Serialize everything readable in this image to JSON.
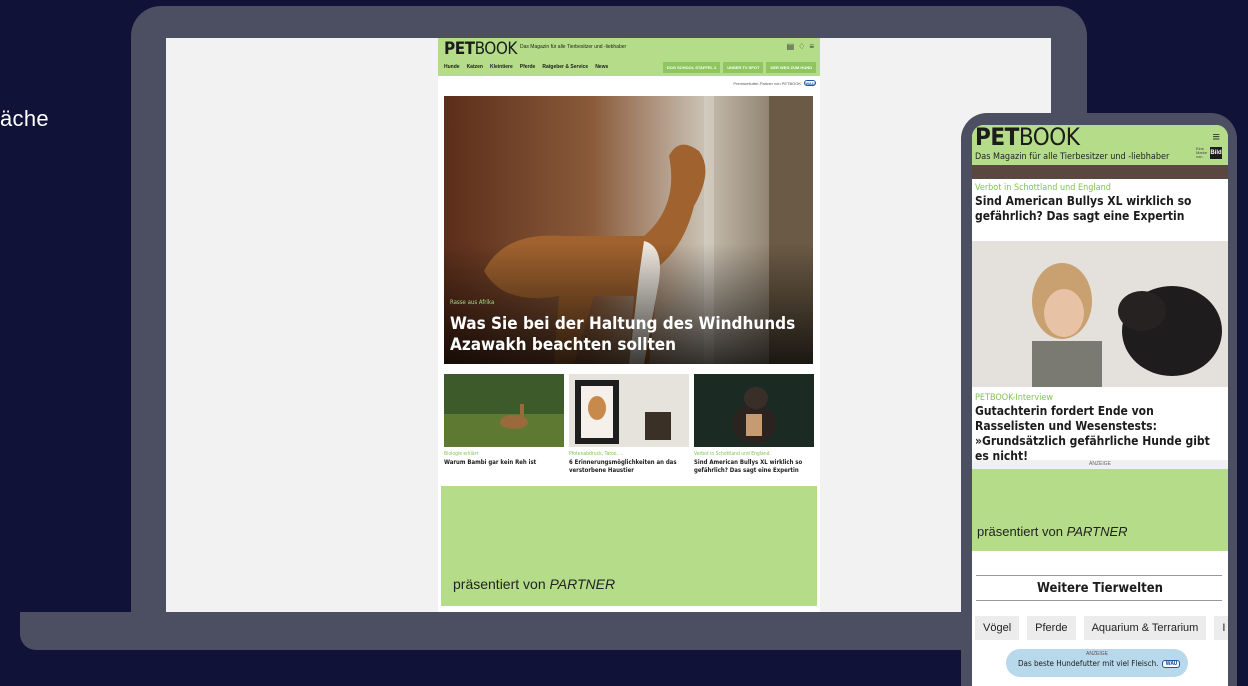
{
  "page": {
    "side_label": "äche"
  },
  "laptop": {
    "site": {
      "logo_bold": "PET",
      "logo_light": "BOOK",
      "tagline": "Das Magazin für alle Tierbesitzer und -liebhaber",
      "nav": [
        "Hunde",
        "Katzen",
        "Kleintiere",
        "Pferde",
        "Ratgeber & Service",
        "News"
      ],
      "nav_buttons": [
        "DOG SCHOOL STAFFEL 2",
        "UNSER TV SPOT",
        "DER WEG ZUM HUND"
      ],
      "partner_line": "Premiumfutter-Partner von PETBOOK",
      "wau_label": "WAU",
      "hero": {
        "kicker": "Rasse aus Afrika",
        "title": "Was Sie bei der Haltung des Windhunds Azawakh beachten sollten"
      },
      "teasers": [
        {
          "kicker": "Biologie erklärt",
          "title": "Warum Bambi gar kein Reh ist"
        },
        {
          "kicker": "Pfotenabdruck, Tatoo, ...",
          "title": "6 Erinnerungsmöglichkeiten an das verstorbene Haustier"
        },
        {
          "kicker": "Verbot in Schottland und England",
          "title": "Sind American Bullys XL wirklich so gefährlich? Das sagt eine Expertin"
        }
      ],
      "ad": {
        "prefix": "präsentiert von ",
        "partner": "PARTNER"
      }
    }
  },
  "phone": {
    "logo_bold": "PET",
    "logo_light": "BOOK",
    "tagline": "Das Magazin für alle Tierbesitzer und -liebhaber",
    "menu_icon": "≡",
    "bild_small": "Eine Marke von",
    "bild_logo": "Bild",
    "article1": {
      "kicker": "Verbot in Schottland und England",
      "title": "Sind American Bullys XL wirklich so gefährlich? Das sagt eine Expertin"
    },
    "article2": {
      "kicker": "PETBOOK-Interview",
      "title": "Gutachterin fordert Ende von Rasselisten und Wesenstests: »Grundsätzlich gefährliche Hunde gibt es nicht!"
    },
    "anzeige": "ANZEIGE",
    "ad": {
      "prefix": "präsentiert von ",
      "partner": "PARTNER"
    },
    "section_title": "Weitere Tierwelten",
    "chips": [
      "Vögel",
      "Pferde",
      "Aquarium & Terrarium",
      "I"
    ],
    "bottom_ad": {
      "label": "ANZEIGE",
      "text": "Das beste Hundefutter mit viel Fleisch.",
      "wau": "WAU"
    }
  },
  "colors": {
    "background": "#101238",
    "device": "#4c4f61",
    "brand_green": "#b5dd89",
    "kicker_green": "#7fc24e"
  }
}
